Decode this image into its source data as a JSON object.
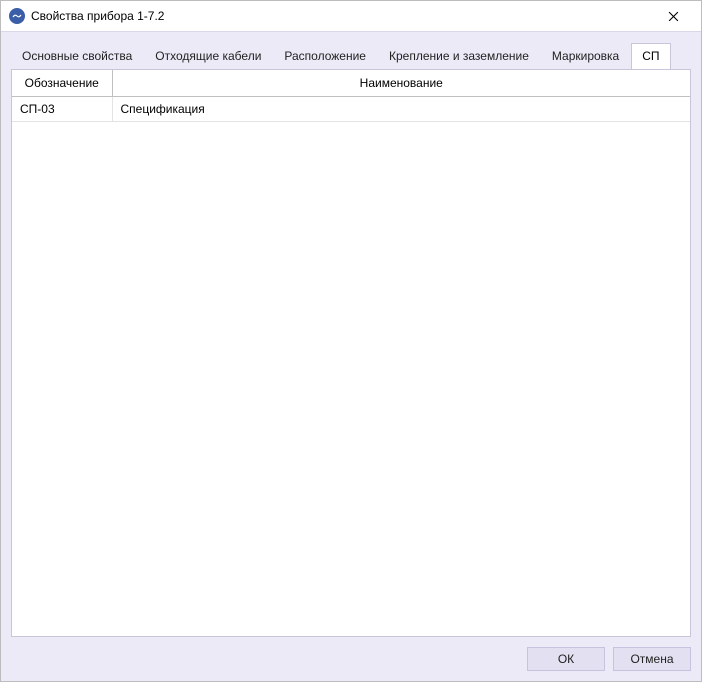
{
  "window": {
    "title": "Свойства прибора 1-7.2"
  },
  "tabs": [
    {
      "label": "Основные свойства",
      "active": false
    },
    {
      "label": "Отходящие кабели",
      "active": false
    },
    {
      "label": "Расположение",
      "active": false
    },
    {
      "label": "Крепление и заземление",
      "active": false
    },
    {
      "label": "Маркировка",
      "active": false
    },
    {
      "label": "СП",
      "active": true
    }
  ],
  "table": {
    "headers": [
      "Обозначение",
      "Наименование"
    ],
    "rows": [
      {
        "code": "СП-03",
        "name": "Спецификация"
      }
    ]
  },
  "buttons": {
    "ok": "ОК",
    "cancel": "Отмена"
  }
}
